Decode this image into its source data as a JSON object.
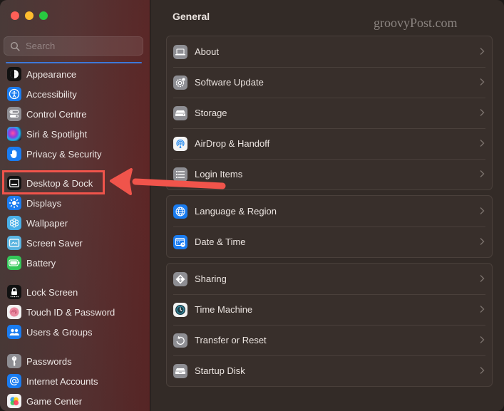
{
  "window": {
    "traffic_lights": [
      "close",
      "minimize",
      "maximize"
    ]
  },
  "sidebar": {
    "search": {
      "placeholder": "Search",
      "value": ""
    },
    "items": [
      {
        "label": "Appearance",
        "icon": "appearance-icon"
      },
      {
        "label": "Accessibility",
        "icon": "accessibility-icon"
      },
      {
        "label": "Control Centre",
        "icon": "control-centre-icon"
      },
      {
        "label": "Siri & Spotlight",
        "icon": "siri-icon"
      },
      {
        "label": "Privacy & Security",
        "icon": "hand-icon"
      },
      {
        "label": "Desktop & Dock",
        "icon": "dock-icon",
        "highlighted": true
      },
      {
        "label": "Displays",
        "icon": "sun-icon"
      },
      {
        "label": "Wallpaper",
        "icon": "wallpaper-icon"
      },
      {
        "label": "Screen Saver",
        "icon": "screen-saver-icon"
      },
      {
        "label": "Battery",
        "icon": "battery-icon"
      },
      {
        "label": "Lock Screen",
        "icon": "lock-icon"
      },
      {
        "label": "Touch ID & Password",
        "icon": "fingerprint-icon"
      },
      {
        "label": "Users & Groups",
        "icon": "users-icon"
      },
      {
        "label": "Passwords",
        "icon": "key-icon"
      },
      {
        "label": "Internet Accounts",
        "icon": "at-icon"
      },
      {
        "label": "Game Center",
        "icon": "game-center-icon"
      }
    ]
  },
  "main": {
    "title": "General",
    "watermark": "groovyPost.com",
    "groups": [
      [
        {
          "label": "About",
          "icon": "laptop-icon"
        },
        {
          "label": "Software Update",
          "icon": "gear-badge-icon"
        },
        {
          "label": "Storage",
          "icon": "drive-icon"
        },
        {
          "label": "AirDrop & Handoff",
          "icon": "airdrop-icon"
        },
        {
          "label": "Login Items",
          "icon": "list-icon"
        }
      ],
      [
        {
          "label": "Language & Region",
          "icon": "globe-icon"
        },
        {
          "label": "Date & Time",
          "icon": "calendar-clock-icon"
        }
      ],
      [
        {
          "label": "Sharing",
          "icon": "sharing-icon"
        },
        {
          "label": "Time Machine",
          "icon": "time-machine-icon"
        },
        {
          "label": "Transfer or Reset",
          "icon": "reset-icon"
        },
        {
          "label": "Startup Disk",
          "icon": "disk-icon"
        }
      ]
    ]
  },
  "annotation": {
    "color": "#f0544b",
    "target": "Desktop & Dock"
  }
}
